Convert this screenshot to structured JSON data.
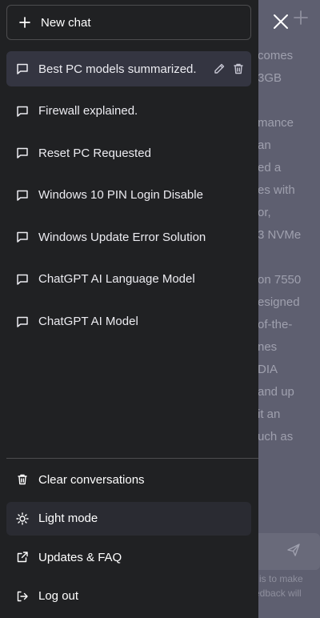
{
  "background_chat": {
    "visible_fragments": [
      "comes",
      "3GB",
      "",
      "mance",
      "an",
      "ed a",
      "es with",
      "or,",
      "3 NVMe",
      "",
      "on 7550",
      "esigned",
      "of-the-",
      "nes",
      "DIA",
      "and up",
      "it an",
      "uch as"
    ],
    "footer_fragments": [
      "l is to make",
      "edback will"
    ]
  },
  "drawer": {
    "new_chat_label": "New chat",
    "history": [
      {
        "label": "Best PC models summarized.",
        "active": true
      },
      {
        "label": "Firewall explained.",
        "active": false
      },
      {
        "label": "Reset PC Requested",
        "active": false
      },
      {
        "label": "Windows 10 PIN Login Disable",
        "active": false
      },
      {
        "label": "Windows Update Error Solution",
        "active": false
      },
      {
        "label": "ChatGPT AI Language Model",
        "active": false
      },
      {
        "label": "ChatGPT AI Model",
        "active": false
      }
    ],
    "menu": [
      {
        "label": "Clear conversations",
        "icon": "trash-icon"
      },
      {
        "label": "Light mode",
        "icon": "sun-icon"
      },
      {
        "label": "Updates & FAQ",
        "icon": "external-link-icon"
      },
      {
        "label": "Log out",
        "icon": "logout-icon"
      }
    ]
  },
  "colors": {
    "drawer_bg": "#202123",
    "active_item_bg": "#343541",
    "overlay_bg": "#5e5f70",
    "text": "#ececf1"
  }
}
